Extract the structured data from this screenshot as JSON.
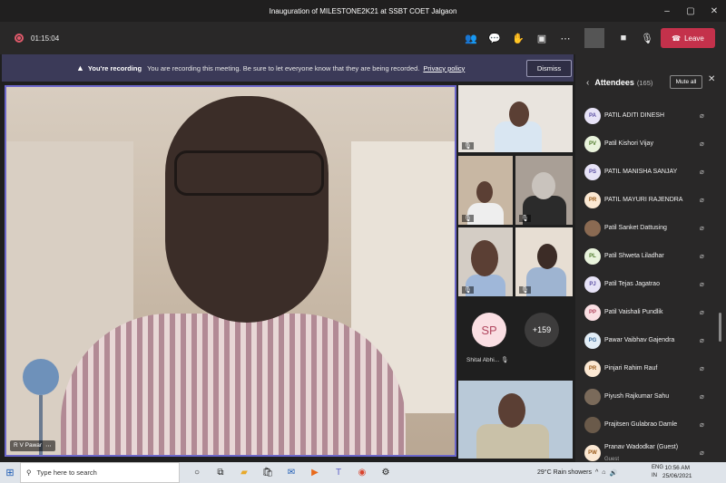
{
  "window": {
    "title": "Inauguration of MILESTONE2K21 at SSBT COET Jalgaon",
    "controls": [
      "–",
      "▢",
      "✕"
    ]
  },
  "toolbar": {
    "timer": "01:15:04",
    "leave_label": "Leave"
  },
  "banner": {
    "heading": "You're recording",
    "message": "You are recording this meeting. Be sure to let everyone know that they are being recorded.",
    "link": "Privacy policy",
    "dismiss_label": "Dismiss"
  },
  "main_video": {
    "name": "R V Pawar"
  },
  "gallery": {
    "sp_initials": "SP",
    "sp_name": "Shital Abhi...",
    "more_count": "+159"
  },
  "attendees": {
    "title": "Attendees",
    "count": "(165)",
    "mute_all_label": "Mute all",
    "items": [
      {
        "initials": "PA",
        "name": "PATIL ADITI DINESH",
        "color": "#e7e3f7",
        "text_color": "#5b4fa3",
        "photo": false
      },
      {
        "initials": "PV",
        "name": "Patil Kishori Vijay",
        "color": "#e9f3dc",
        "text_color": "#4d7a2a",
        "photo": false
      },
      {
        "initials": "PS",
        "name": "PATIL MANISHA SANJAY",
        "color": "#e7e3f7",
        "text_color": "#5b4fa3",
        "photo": false
      },
      {
        "initials": "PR",
        "name": "PATIL MAYURI RAJENDRA",
        "color": "#fbe8d3",
        "text_color": "#9a5a1a",
        "photo": false
      },
      {
        "initials": "",
        "name": "Patil Sanket Dattusing",
        "color": "#8a6a52",
        "text_color": "#fff",
        "photo": true
      },
      {
        "initials": "PL",
        "name": "Patil Shweta Liladhar",
        "color": "#e9f3dc",
        "text_color": "#4d7a2a",
        "photo": false
      },
      {
        "initials": "PJ",
        "name": "Patil Tejas Jagatrao",
        "color": "#e7e3f7",
        "text_color": "#5b4fa3",
        "photo": false
      },
      {
        "initials": "PP",
        "name": "Patil Vaishali Pundlik",
        "color": "#fadfe3",
        "text_color": "#b1475f",
        "photo": false
      },
      {
        "initials": "PG",
        "name": "Pawar Vaibhav Gajendra",
        "color": "#e3eef7",
        "text_color": "#3b6b9a",
        "photo": false
      },
      {
        "initials": "PR",
        "name": "Pinjari Rahim Rauf",
        "color": "#fbe8d3",
        "text_color": "#9a5a1a",
        "photo": false
      },
      {
        "initials": "",
        "name": "Piyush Rajkumar Sahu",
        "color": "#7a6a5a",
        "text_color": "#fff",
        "photo": true
      },
      {
        "initials": "",
        "name": "Prajitsen Gulabrao Damle",
        "color": "#6a5a4a",
        "text_color": "#fff",
        "photo": true
      },
      {
        "initials": "PW",
        "name": "Pranav Wadodkar (Guest)",
        "sub": "Guest",
        "color": "#fbe8d3",
        "text_color": "#9a5a1a",
        "photo": false
      }
    ]
  },
  "taskbar": {
    "search_placeholder": "Type here to search",
    "weather": "29°C  Rain showers",
    "lang_line1": "ENG",
    "lang_line2": "IN",
    "time": "10:56 AM",
    "date": "25/06/2021"
  }
}
